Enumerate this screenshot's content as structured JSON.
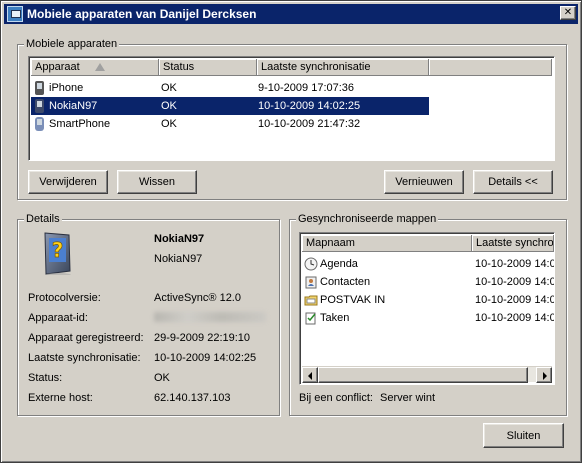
{
  "window": {
    "title": "Mobiele apparaten van Danijel Dercksen",
    "close_glyph": "✕"
  },
  "devices_group": {
    "label": "Mobiele apparaten",
    "columns": [
      "Apparaat",
      "Status",
      "Laatste synchronisatie"
    ],
    "rows": [
      {
        "name": "iPhone",
        "status": "OK",
        "last_sync": "9-10-2009 17:07:36",
        "icon": "iphone-icon",
        "selected": false
      },
      {
        "name": "NokiaN97",
        "status": "OK",
        "last_sync": "10-10-2009 14:02:25",
        "icon": "nokia-phone-icon",
        "selected": true
      },
      {
        "name": "SmartPhone",
        "status": "OK",
        "last_sync": "10-10-2009 21:47:32",
        "icon": "smartphone-icon",
        "selected": false
      }
    ],
    "buttons": {
      "remove": "Verwijderen",
      "wipe": "Wissen",
      "refresh": "Vernieuwen",
      "details": "Details <<"
    }
  },
  "details_group": {
    "label": "Details",
    "device_name": "NokiaN97",
    "device_model": "NokiaN97",
    "fields": [
      {
        "label": "Protocolversie:",
        "value": "ActiveSync® 12.0"
      },
      {
        "label": "Apparaat-id:",
        "value": ""
      },
      {
        "label": "Apparaat geregistreerd:",
        "value": "29-9-2009 22:19:10"
      },
      {
        "label": "Laatste synchronisatie:",
        "value": "10-10-2009 14:02:25"
      },
      {
        "label": "Status:",
        "value": "OK"
      },
      {
        "label": "Externe host:",
        "value": "62.140.137.103"
      }
    ]
  },
  "folders_group": {
    "label": "Gesynchroniseerde mappen",
    "columns": [
      "Mapnaam",
      "Laatste synchro"
    ],
    "rows": [
      {
        "name": "Agenda",
        "last_sync": "10-10-2009 14:0",
        "icon": "calendar-icon"
      },
      {
        "name": "Contacten",
        "last_sync": "10-10-2009 14:0",
        "icon": "contacts-icon"
      },
      {
        "name": "POSTVAK IN",
        "last_sync": "10-10-2009 14:0",
        "icon": "inbox-icon"
      },
      {
        "name": "Taken",
        "last_sync": "10-10-2009 14:0",
        "icon": "tasks-icon"
      }
    ],
    "conflict_label": "Bij een conflict:",
    "conflict_value": "Server wint"
  },
  "footer": {
    "close_label": "Sluiten"
  }
}
